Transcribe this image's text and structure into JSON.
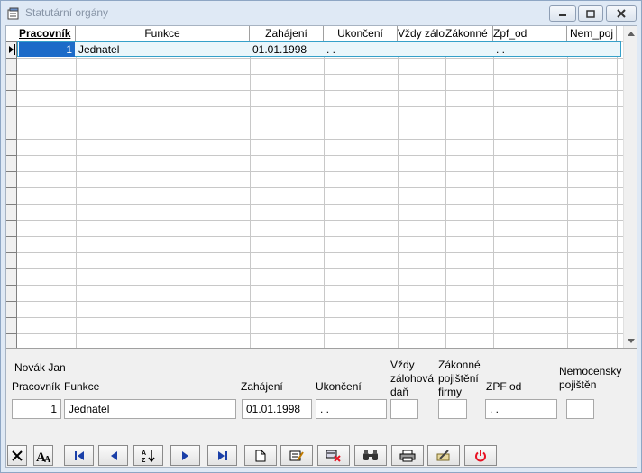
{
  "window": {
    "title": "Statutární orgány"
  },
  "grid": {
    "columns": [
      "Pracovník",
      "Funkce",
      "Zahájení",
      "Ukončení",
      "Vždy zálohov",
      "Zákonné",
      "Zpf_od",
      "Nem_poj"
    ],
    "rows": [
      {
        "pracovnik": "1",
        "funkce": "Jednatel",
        "zahajeni": "01.01.1998",
        "ukonceni": ". .",
        "vzdy": "",
        "zakonne": "",
        "zpf_od": ". .",
        "nem_poj": ""
      }
    ]
  },
  "detail": {
    "employee_name": "Novák Jan",
    "labels": {
      "pracovnik": "Pracovník",
      "funkce": "Funkce",
      "zahajeni": "Zahájení",
      "ukonceni": "Ukončení",
      "vzdy_1": "Vždy",
      "vzdy_2": "zálohová",
      "vzdy_3": "daň",
      "zak_1": "Zákonné",
      "zak_2": "pojištění",
      "zak_3": "firmy",
      "zpf_od": "ZPF od",
      "nem_1": "Nemocensky",
      "nem_2": "pojištěn"
    },
    "values": {
      "pracovnik": "1",
      "funkce": "Jednatel",
      "zahajeni": "01.01.1998",
      "ukonceni": ". .",
      "vzdy": "",
      "zakonne": "",
      "zpf_od": ". .",
      "nem": ""
    }
  },
  "colors": {
    "selection": "#1c6bc8",
    "row_border": "#35a0c9",
    "close_icon": "#e81123"
  }
}
